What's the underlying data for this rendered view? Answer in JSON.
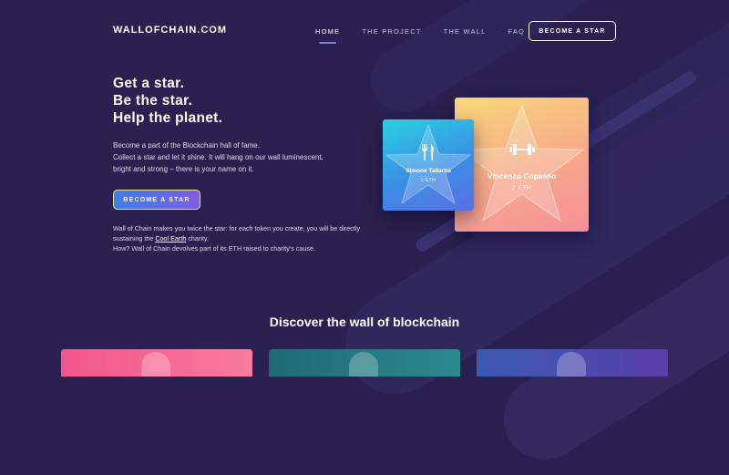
{
  "header": {
    "logo": "WALLOFCHAIN.COM",
    "nav": [
      {
        "label": "HOME",
        "active": true
      },
      {
        "label": "THE PROJECT",
        "active": false
      },
      {
        "label": "THE WALL",
        "active": false
      },
      {
        "label": "FAQ",
        "active": false
      }
    ],
    "cta_label": "BECOME A STAR"
  },
  "hero": {
    "headline": [
      "Get a star.",
      "Be the star.",
      "Help the planet."
    ],
    "description": [
      "Become a part of the Blockchain hall of fame.",
      "Collect a star and let it shine. It will hang on our wall luminescent,",
      "bright and strong – there is your name on it."
    ],
    "cta_label": "BECOME A STAR",
    "note": {
      "part1": "Wall of Chain makes you twice the star: for each token you create, you will be directly sustaining the ",
      "link": "Cool Earth",
      "part2": " charity.",
      "line2": "How? Wall of Chain devolves part of its ETH raised to charity's cause."
    }
  },
  "cards": [
    {
      "name": "Vincenzo Copasso",
      "amount": "2 ETH",
      "icon": "dumbbell-icon"
    },
    {
      "name": "Simone Tallarita",
      "amount": "1 ETH",
      "icon": "fork-knife-icon"
    }
  ],
  "section": {
    "title": "Discover the wall of blockchain"
  },
  "colors": {
    "background": "#2a2150",
    "accent_blue": "#3d7ee8",
    "accent_purple": "#7c5de0",
    "card_orange": "#f7a98a",
    "card_cyan": "#2bd0e0"
  }
}
